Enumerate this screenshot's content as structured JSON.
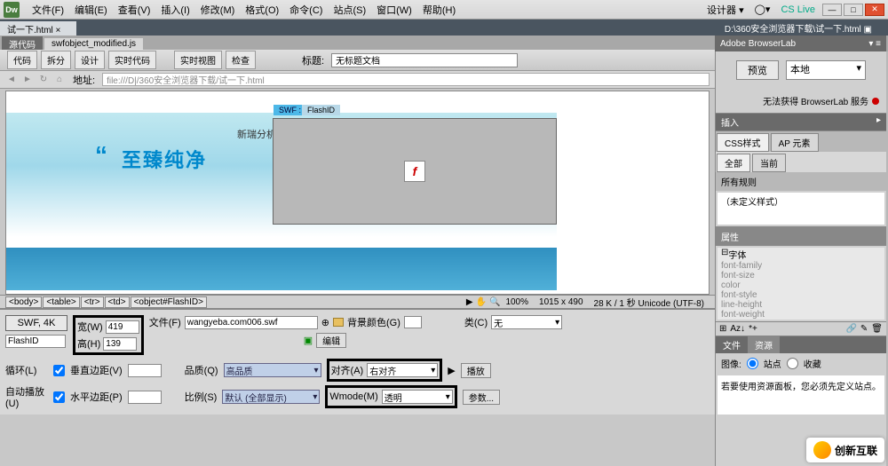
{
  "app": {
    "logo": "Dw"
  },
  "menu": {
    "items": [
      "文件(F)",
      "编辑(E)",
      "查看(V)",
      "插入(I)",
      "修改(M)",
      "格式(O)",
      "命令(C)",
      "站点(S)",
      "窗口(W)",
      "帮助(H)"
    ],
    "right": {
      "designer": "设计器 ▾",
      "search": "◯▾",
      "cslive": "CS Live"
    }
  },
  "tabs": {
    "file": "试一下.html ×",
    "path": "D:\\360安全浏览器下载\\试一下.html ▣"
  },
  "subtabs": {
    "source": "源代码",
    "js": "swfobject_modified.js"
  },
  "toolbar": {
    "code": "代码",
    "split": "拆分",
    "design": "设计",
    "live_code": "实时代码",
    "live_view": "实时视图",
    "inspect": "检查",
    "title_label": "标题:",
    "title_value": "无标题文档"
  },
  "addr": {
    "label": "地址:",
    "value": "file:///D|/360安全浏览器下载/试一下.html"
  },
  "canvas": {
    "flash_tag": "SWF :",
    "flash_id": "FlashID",
    "subtext": "新瑞分机",
    "slogan": "至臻纯净",
    "quote": "“"
  },
  "crumbs": {
    "items": [
      "<body>",
      "<table>",
      "<tr>",
      "<td>",
      "<object#FlashID>"
    ],
    "zoom": "100%",
    "dims": "1015 x 490",
    "info": "28 K / 1 秒 Unicode (UTF-8)"
  },
  "props": {
    "swf": "SWF, 4K",
    "id": "FlashID",
    "w_label": "宽(W)",
    "w": "419",
    "h_label": "高(H)",
    "h": "139",
    "file_label": "文件(F)",
    "file_value": "wangyeba.com006.swf",
    "bg_label": "背景颜色(G)",
    "class_label": "类(C)",
    "class_value": "无",
    "edit_btn": "编辑",
    "loop_label": "循环(L)",
    "vmargin_label": "垂直边距(V)",
    "quality_label": "品质(Q)",
    "quality_value": "高品质",
    "align_label": "对齐(A)",
    "align_value": "右对齐",
    "play_btn": "播放",
    "autoplay_label": "自动播放(U)",
    "hmargin_label": "水平边距(P)",
    "scale_label": "比例(S)",
    "scale_value": "默认 (全部显示)",
    "wmode_label": "Wmode(M)",
    "wmode_value": "透明",
    "params_btn": "参数..."
  },
  "rpanel": {
    "browserlab": "Adobe BrowserLab",
    "preview": "预览",
    "local": "本地",
    "bl_status": "无法获得 BrowserLab 服务",
    "insert": "插入",
    "css_tab": "CSS样式",
    "ap_tab": "AP 元素",
    "all": "全部",
    "current": "当前",
    "rules": "所有规则",
    "no_rules": "（未定义样式）",
    "properties": "属性",
    "font": "字体",
    "fprops": [
      "font-family",
      "font-size",
      "color",
      "font-style",
      "line-height",
      "font-weight"
    ],
    "files_tab": "文件",
    "assets_tab": "资源",
    "img_label": "图像:",
    "site_radio": "站点",
    "fav_radio": "收藏",
    "asset_msg": "若要使用资源面板，您必须先定义站点。"
  },
  "watermark": "创新互联"
}
